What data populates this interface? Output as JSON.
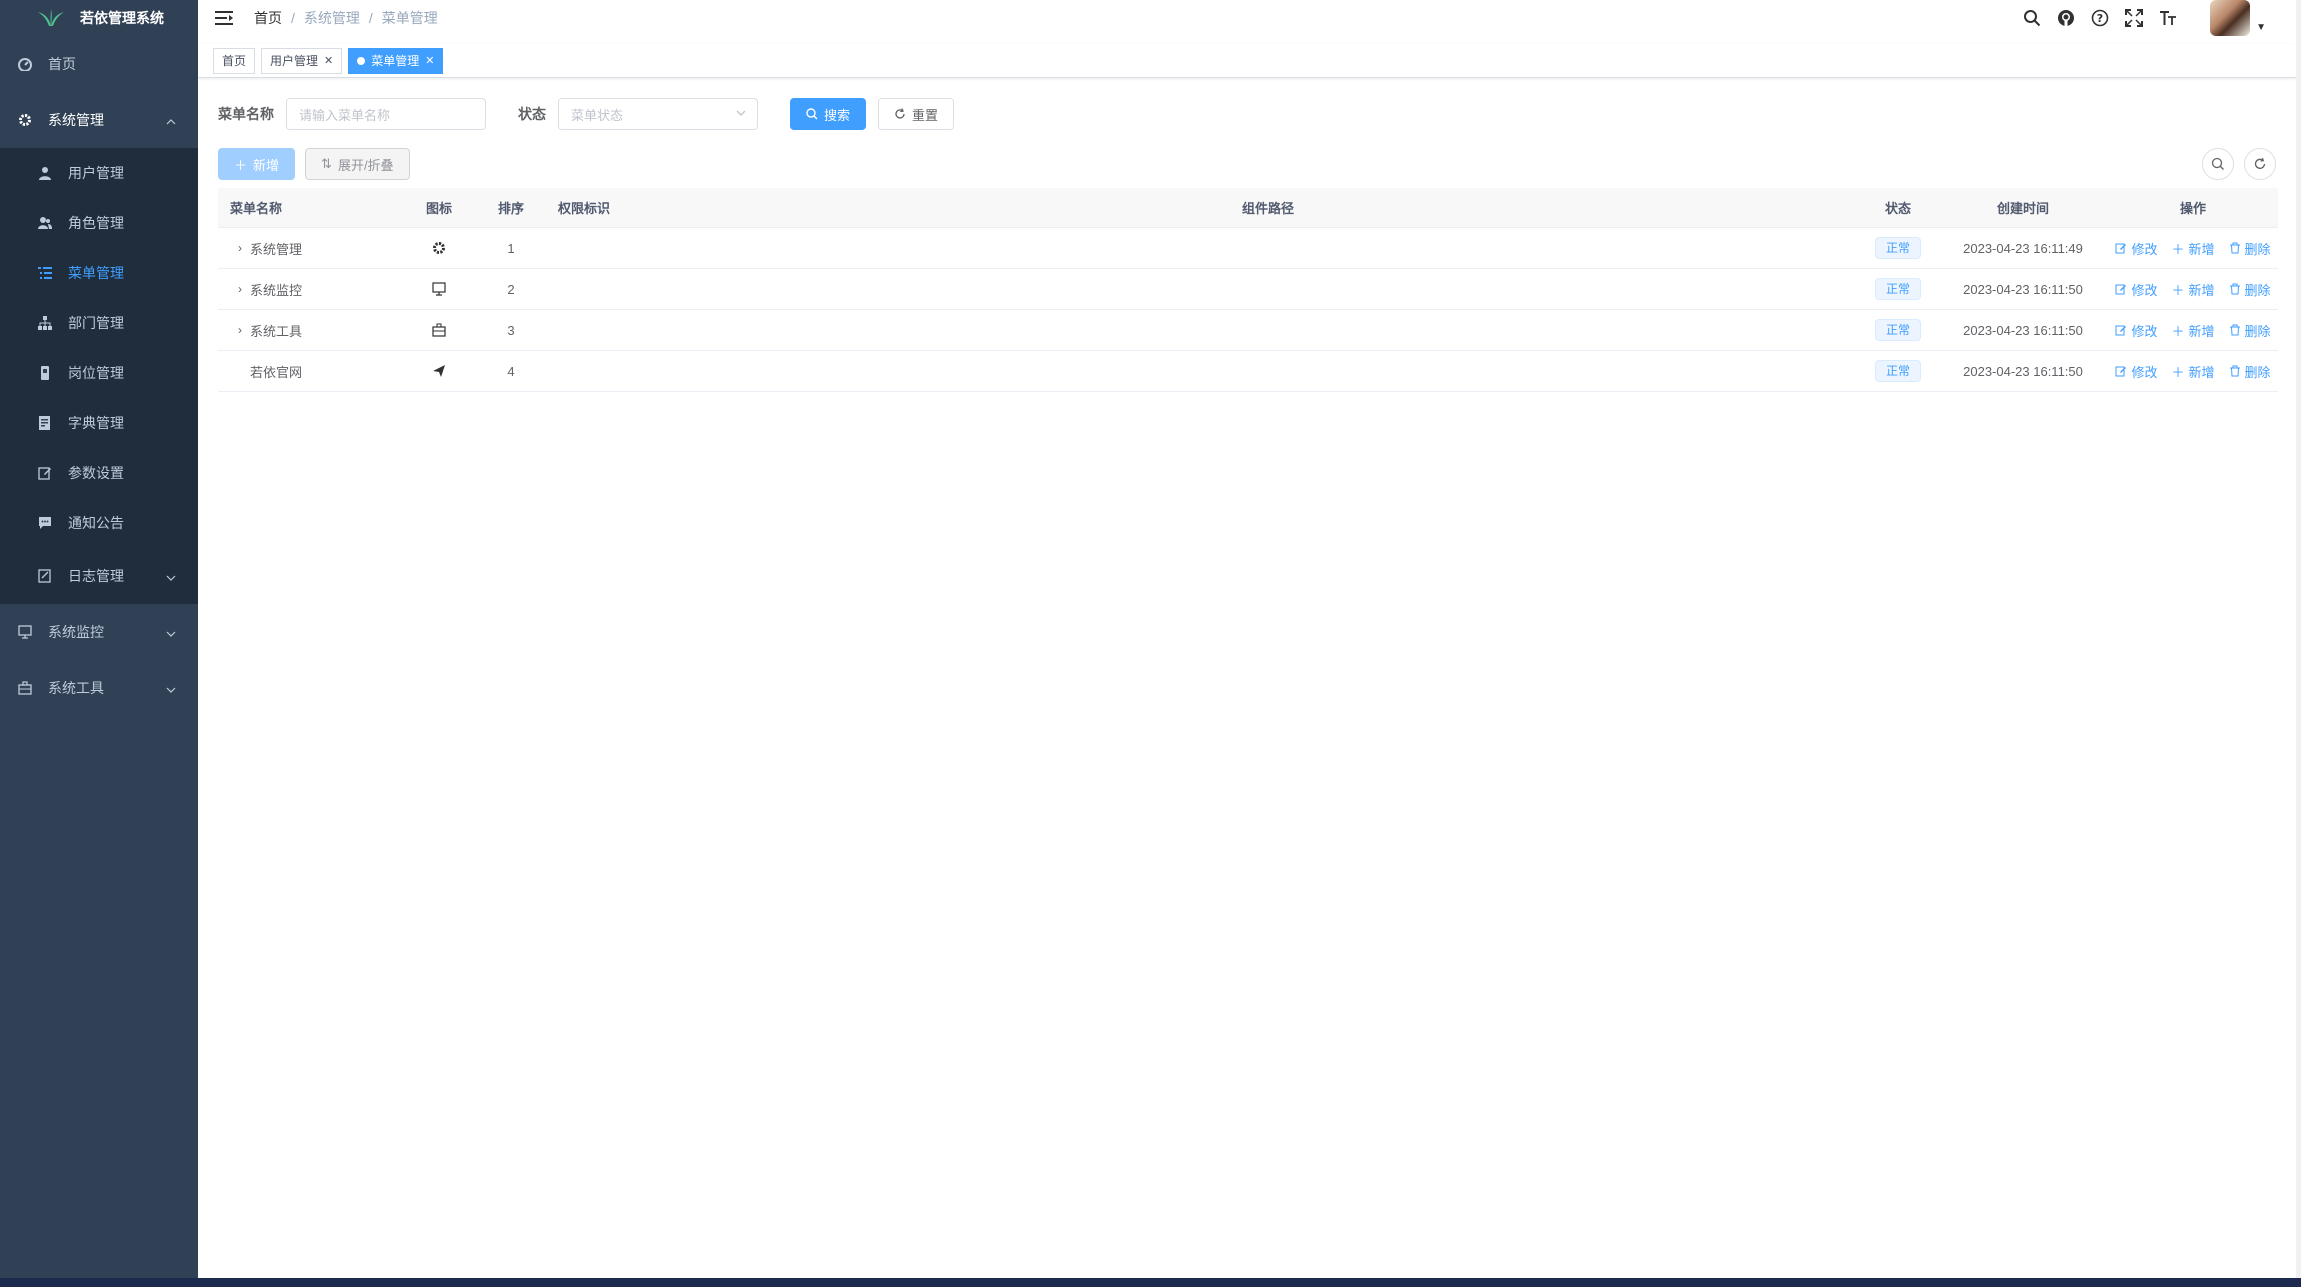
{
  "app": {
    "title": "若依管理系统",
    "brand_color": "#409eff",
    "sidebar_bg": "#304156"
  },
  "sidebar": {
    "items": [
      {
        "label": "首页",
        "icon": "dashboard-icon"
      },
      {
        "label": "系统管理",
        "icon": "gear-icon",
        "open": true
      },
      {
        "label": "系统监控",
        "icon": "monitor-icon"
      },
      {
        "label": "系统工具",
        "icon": "toolbox-icon"
      }
    ],
    "sub_items": [
      {
        "label": "用户管理",
        "icon": "user-icon"
      },
      {
        "label": "角色管理",
        "icon": "peoples-icon"
      },
      {
        "label": "菜单管理",
        "icon": "tree-table-icon",
        "active": true
      },
      {
        "label": "部门管理",
        "icon": "tree-icon"
      },
      {
        "label": "岗位管理",
        "icon": "post-icon"
      },
      {
        "label": "字典管理",
        "icon": "dict-icon"
      },
      {
        "label": "参数设置",
        "icon": "edit-icon"
      },
      {
        "label": "通知公告",
        "icon": "message-icon"
      },
      {
        "label": "日志管理",
        "icon": "log-icon"
      }
    ]
  },
  "header": {
    "breadcrumb": [
      "首页",
      "系统管理",
      "菜单管理"
    ]
  },
  "tags": [
    {
      "label": "首页"
    },
    {
      "label": "用户管理"
    },
    {
      "label": "菜单管理",
      "active": true
    }
  ],
  "search": {
    "menu_name_label": "菜单名称",
    "menu_name_placeholder": "请输入菜单名称",
    "status_label": "状态",
    "status_placeholder": "菜单状态",
    "search_button": "搜索",
    "reset_button": "重置"
  },
  "toolbar": {
    "add_button": "新增",
    "toggle_button": "展开/折叠"
  },
  "table": {
    "headers": {
      "name": "菜单名称",
      "icon": "图标",
      "order": "排序",
      "perms": "权限标识",
      "component": "组件路径",
      "status": "状态",
      "created": "创建时间",
      "ops": "操作"
    },
    "rows": [
      {
        "name": "系统管理",
        "icon": "gear-icon",
        "order": "1",
        "status": "正常",
        "created": "2023-04-23 16:11:49",
        "expandable": true
      },
      {
        "name": "系统监控",
        "icon": "monitor-icon",
        "order": "2",
        "status": "正常",
        "created": "2023-04-23 16:11:50",
        "expandable": true
      },
      {
        "name": "系统工具",
        "icon": "toolbox-icon",
        "order": "3",
        "status": "正常",
        "created": "2023-04-23 16:11:50",
        "expandable": true
      },
      {
        "name": "若依官网",
        "icon": "send-icon",
        "order": "4",
        "status": "正常",
        "created": "2023-04-23 16:11:50",
        "expandable": false
      }
    ],
    "ops": {
      "edit": "修改",
      "add": "新增",
      "delete": "删除"
    }
  }
}
